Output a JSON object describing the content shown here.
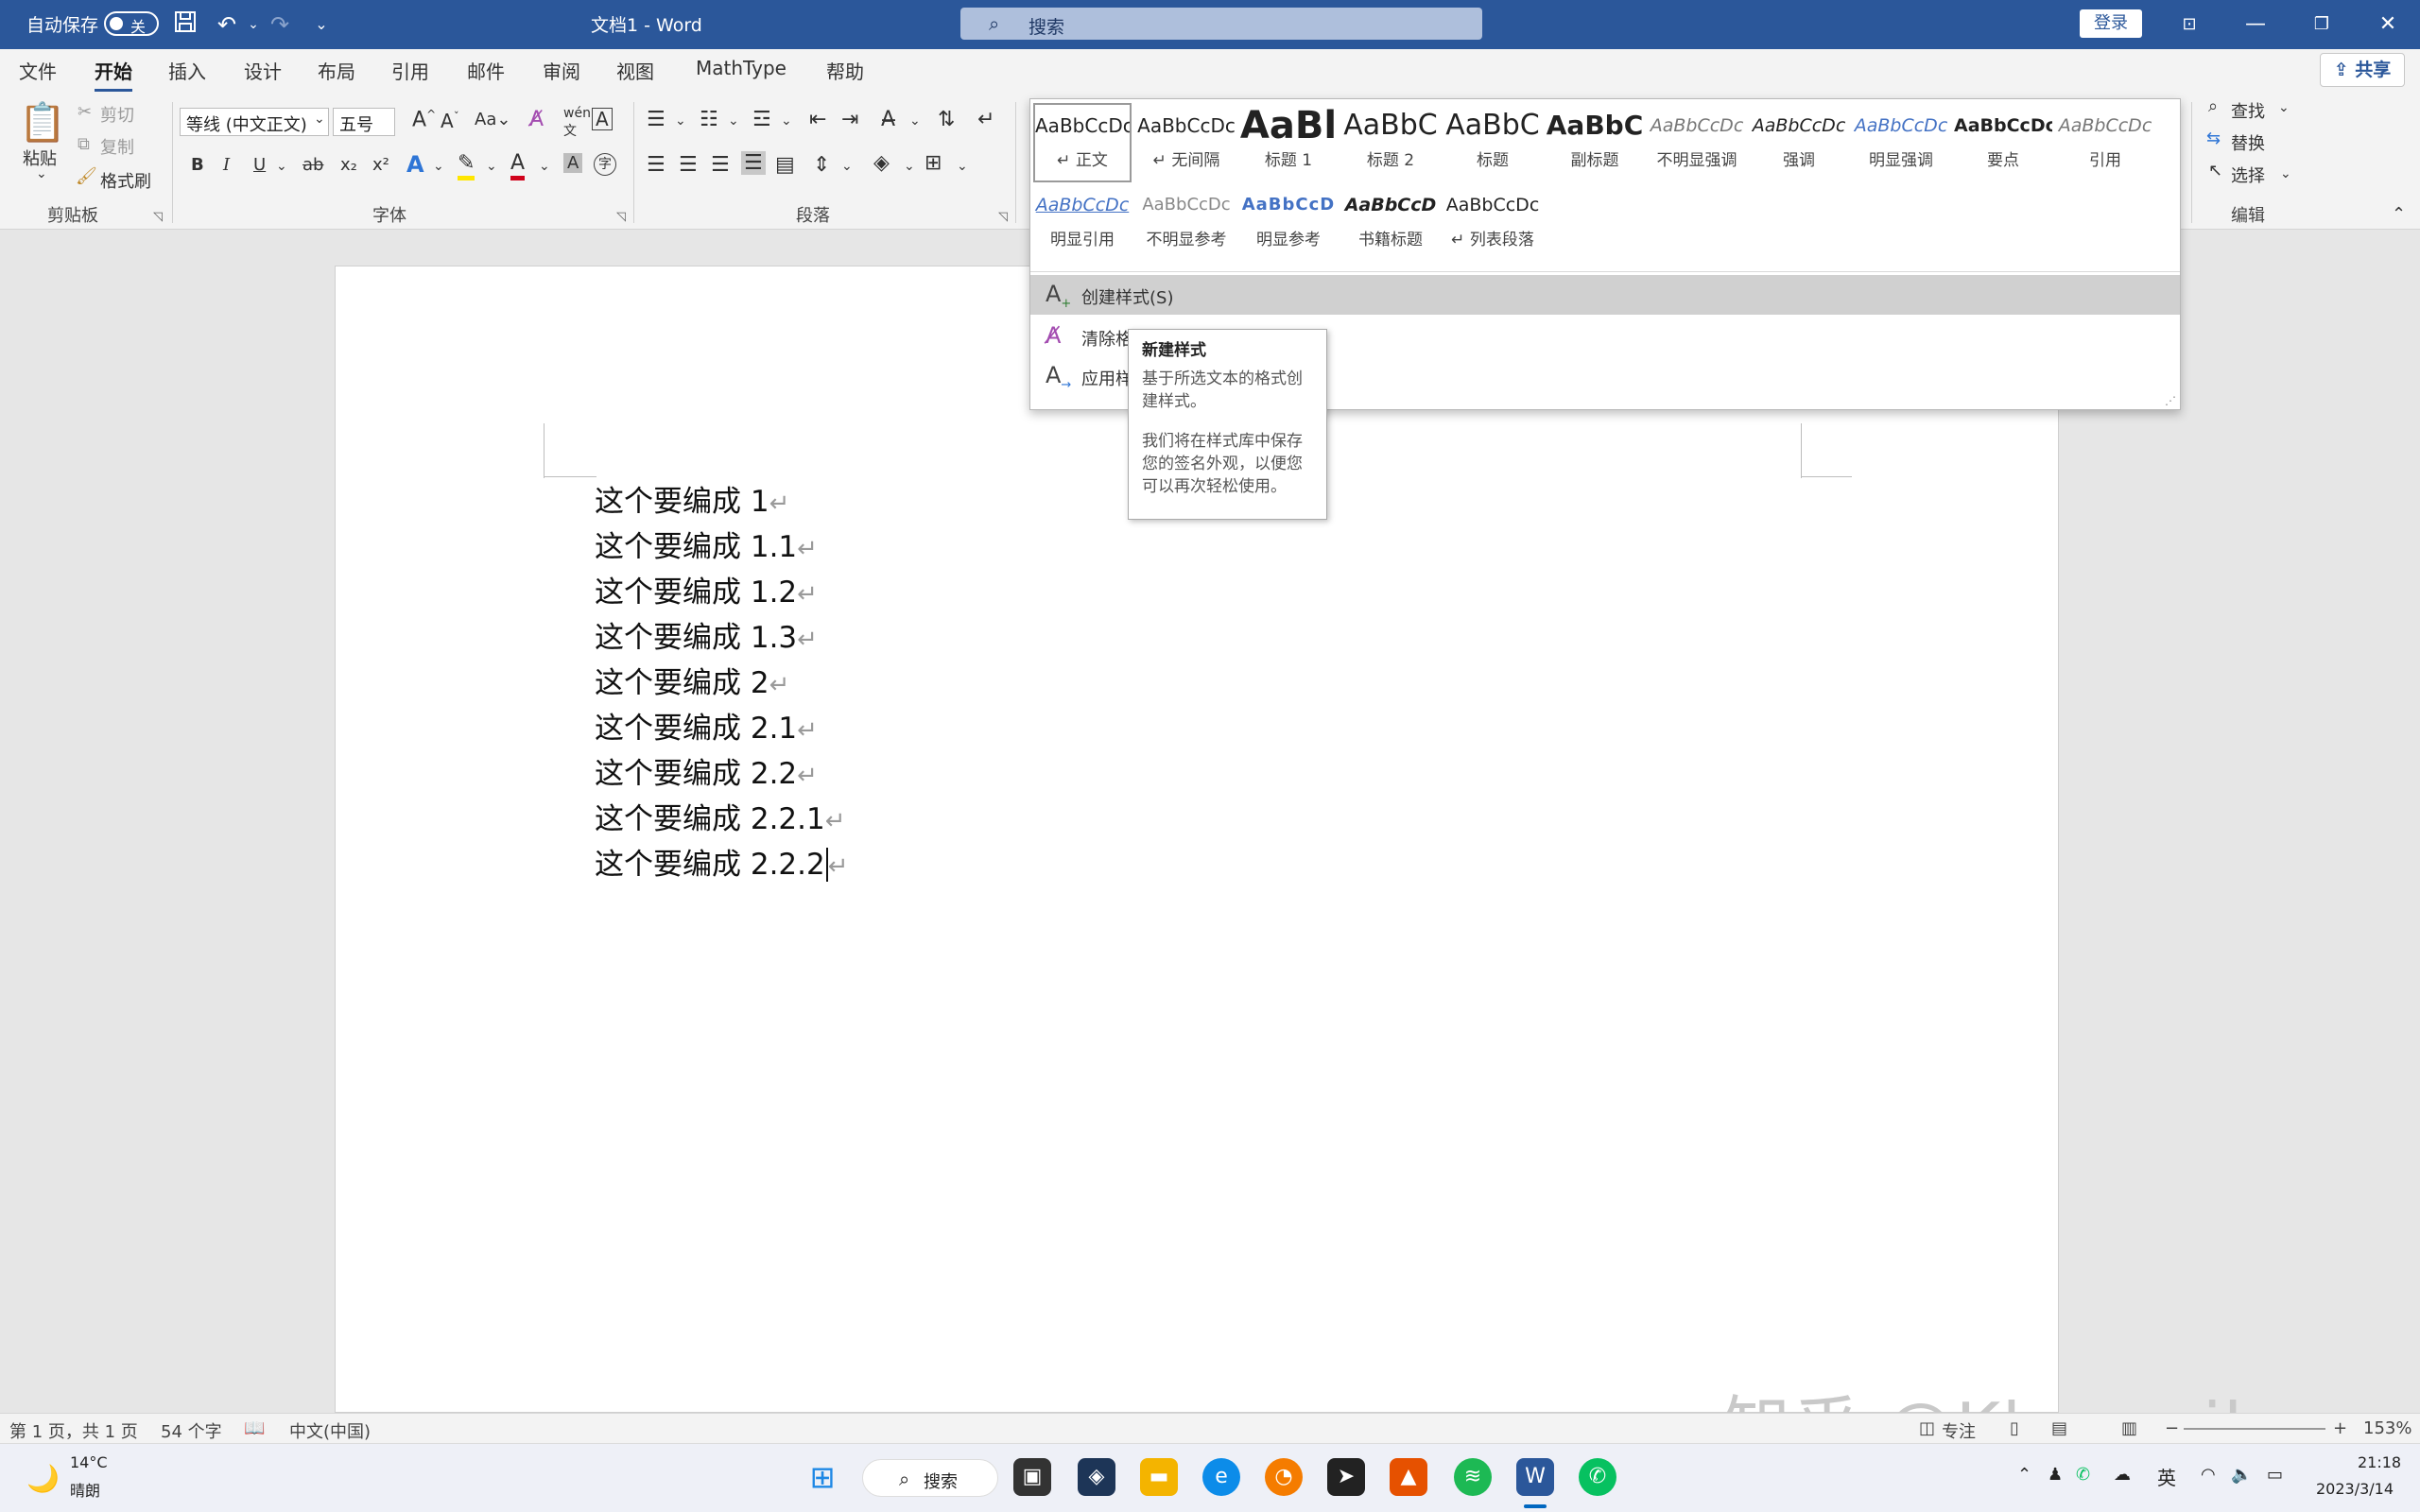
{
  "titlebar": {
    "autosave_label": "自动保存",
    "autosave_state": "关",
    "doc_title": "文档1 - Word",
    "search_placeholder": "搜索",
    "login_label": "登录"
  },
  "menu": {
    "tabs": [
      "文件",
      "开始",
      "插入",
      "设计",
      "布局",
      "引用",
      "邮件",
      "审阅",
      "视图",
      "MathType",
      "帮助"
    ],
    "active_tab": "开始",
    "share_label": "共享"
  },
  "ribbon": {
    "clipboard": {
      "paste": "粘贴",
      "cut": "剪切",
      "copy": "复制",
      "format_painter": "格式刷",
      "group_label": "剪贴板"
    },
    "font": {
      "font_name": "等线 (中文正文)",
      "font_size": "五号",
      "group_label": "字体",
      "case_label": "Aa",
      "bold": "B",
      "italic": "I",
      "underline": "U",
      "strike": "ab",
      "subscript": "x₂",
      "superscript": "x²",
      "text_effects": "A",
      "font_color": "A",
      "char_shading": "A",
      "enclose": "字"
    },
    "paragraph": {
      "group_label": "段落"
    },
    "editing": {
      "find": "查找",
      "replace": "替换",
      "select": "选择",
      "group_label": "编辑"
    }
  },
  "styles_gallery": {
    "row1": [
      {
        "preview": "AaBbCcDc",
        "name": "正文",
        "prefix": "↵"
      },
      {
        "preview": "AaBbCcDc",
        "name": "无间隔",
        "prefix": "↵"
      },
      {
        "preview": "AaBl",
        "name": "标题 1",
        "prefix": ""
      },
      {
        "preview": "AaBbC",
        "name": "标题 2",
        "prefix": ""
      },
      {
        "preview": "AaBbC",
        "name": "标题",
        "prefix": ""
      },
      {
        "preview": "AaBbC",
        "name": "副标题",
        "prefix": ""
      },
      {
        "preview": "AaBbCcDc",
        "name": "不明显强调",
        "prefix": ""
      },
      {
        "preview": "AaBbCcDc",
        "name": "强调",
        "prefix": ""
      },
      {
        "preview": "AaBbCcDc",
        "name": "明显强调",
        "prefix": ""
      },
      {
        "preview": "AaBbCcDc",
        "name": "要点",
        "prefix": ""
      },
      {
        "preview": "AaBbCcDc",
        "name": "引用",
        "prefix": ""
      }
    ],
    "row2": [
      {
        "preview": "AaBbCcDc",
        "name": "明显引用",
        "prefix": ""
      },
      {
        "preview": "AaBbCcDc",
        "name": "不明显参考",
        "prefix": ""
      },
      {
        "preview": "AaBbCcD",
        "name": "明显参考",
        "prefix": ""
      },
      {
        "preview": "AaBbCcD",
        "name": "书籍标题",
        "prefix": ""
      },
      {
        "preview": "AaBbCcDc",
        "name": "列表段落",
        "prefix": "↵"
      }
    ],
    "actions": [
      "创建样式(S)",
      "清除格式(C)",
      "应用样式(A)..."
    ],
    "actions_visible": [
      "创建样式(S)",
      "清除格",
      "应用样"
    ]
  },
  "tooltip": {
    "title": "新建样式",
    "line1": "基于所选文本的格式创建样式。",
    "line2": "我们将在样式库中保存您的签名外观，以便您可以再次轻松使用。"
  },
  "document": {
    "lines": [
      "这个要编成 1",
      "这个要编成 1.1",
      "这个要编成 1.2",
      "这个要编成 1.3",
      "这个要编成 2",
      "这个要编成 2.1",
      "这个要编成 2.2",
      "这个要编成 2.2.1",
      "这个要编成 2.2.2"
    ],
    "paragraph_mark": "↵"
  },
  "statusbar": {
    "page": "第 1 页，共 1 页",
    "words": "54 个字",
    "language": "中文(中国)",
    "focus": "专注",
    "zoom": "153%"
  },
  "watermark": "知乎 @Khamaileon",
  "taskbar": {
    "weather_temp": "14°C",
    "weather_desc": "晴朗",
    "search_label": "搜索",
    "ime": "英",
    "time": "21:18",
    "date": "2023/3/14"
  },
  "colors": {
    "titlebar": "#2b579a",
    "ribbon": "#f3f3f3",
    "page": "#ffffff"
  }
}
